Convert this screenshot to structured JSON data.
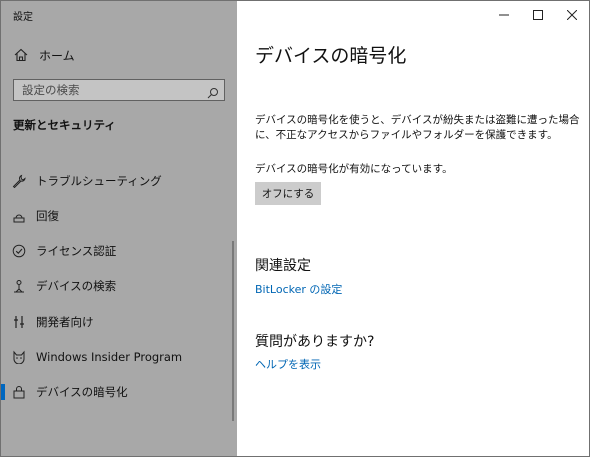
{
  "window": {
    "title": "設定"
  },
  "sidebar": {
    "home_label": "ホーム",
    "search_placeholder": "設定の検索",
    "section_title": "更新とセキュリティ",
    "partial_item": "・・・・・",
    "items": [
      {
        "label": "トラブルシューティング",
        "icon": "wrench-icon"
      },
      {
        "label": "回復",
        "icon": "recovery-icon"
      },
      {
        "label": "ライセンス認証",
        "icon": "check-circle-icon"
      },
      {
        "label": "デバイスの検索",
        "icon": "person-pin-icon"
      },
      {
        "label": "開発者向け",
        "icon": "developer-icon"
      },
      {
        "label": "Windows Insider Program",
        "icon": "cat-icon"
      },
      {
        "label": "デバイスの暗号化",
        "icon": "encryption-icon",
        "active": true
      }
    ]
  },
  "main": {
    "title": "デバイスの暗号化",
    "description": "デバイスの暗号化を使うと、デバイスが紛失または盗難に遭った場合に、不正なアクセスからファイルやフォルダーを保護できます。",
    "status": "デバイスの暗号化が有効になっています。",
    "button_label": "オフにする",
    "related_title": "関連設定",
    "related_link": "BitLocker の設定",
    "question_title": "質問がありますか?",
    "help_link": "ヘルプを表示"
  },
  "colors": {
    "sidebar_bg": "#a8a8a8",
    "accent": "#0067c0",
    "link": "#0066b4",
    "button_bg": "#cccccc"
  }
}
